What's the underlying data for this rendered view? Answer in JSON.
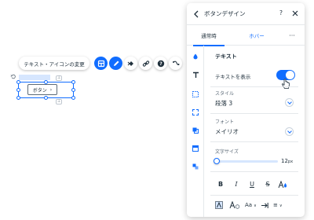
{
  "toolbar": {
    "pill_label": "テキスト・アイコンの変更",
    "icons": [
      "layout-icon",
      "pen-icon",
      "animation-icon",
      "link-icon",
      "help-icon",
      "connect-icon"
    ],
    "accent": "#116dff"
  },
  "canvas_button": {
    "label": "ボタン"
  },
  "panel": {
    "title": "ボタンデザイン",
    "help": "?",
    "tabs": [
      "通常時",
      "ホバー",
      "···"
    ],
    "section_title": "テキスト",
    "show_text_label": "テキストを表示",
    "show_text_on": true,
    "style_label": "スタイル",
    "style_value": "段落 3",
    "font_label": "フォント",
    "font_value": "メイリオ",
    "size_label": "文字サイズ",
    "size_value": "12",
    "size_unit": "px",
    "format_row1": [
      "B",
      "I",
      "U",
      "S"
    ],
    "format_row2": [
      "Aa",
      "≡"
    ]
  }
}
